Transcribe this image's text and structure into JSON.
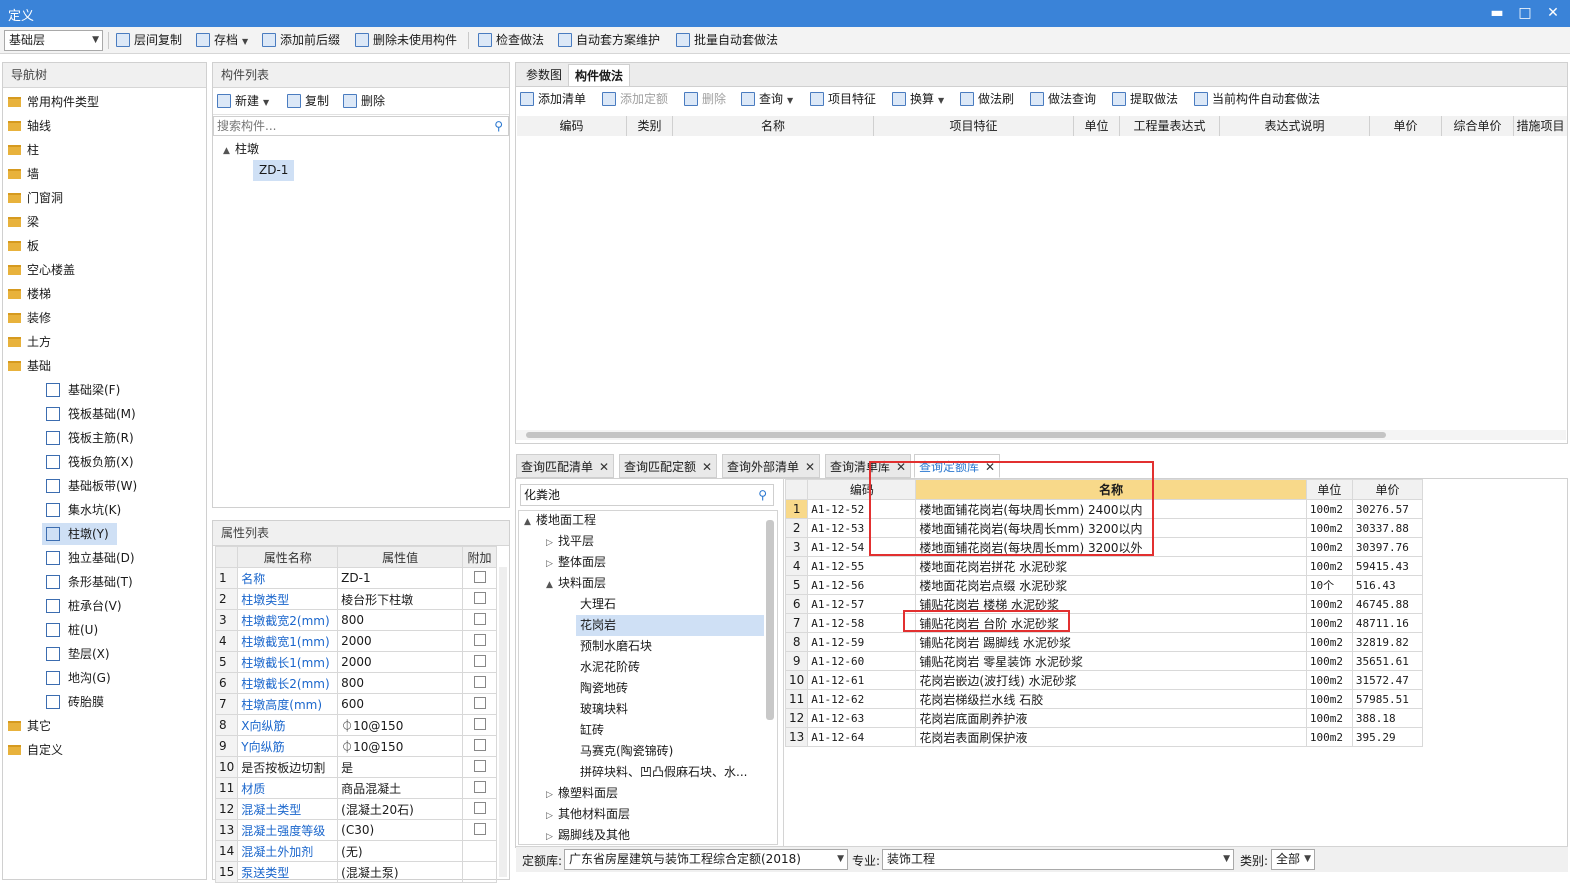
{
  "window": {
    "title": "定义"
  },
  "window_controls": {
    "minimize": "▬",
    "maximize": "□",
    "close": "✕"
  },
  "toolbar": {
    "layer": "基础层",
    "buttons": [
      "层间复制",
      "存档",
      "添加前后缀",
      "删除未使用构件",
      "检查做法",
      "自动套方案维护",
      "批量自动套做法"
    ]
  },
  "nav": {
    "title": "导航树",
    "items": [
      "常用构件类型",
      "轴线",
      "柱",
      "墙",
      "门窗洞",
      "梁",
      "板",
      "空心楼盖",
      "楼梯",
      "装修",
      "土方",
      "基础"
    ],
    "sub_items": [
      "基础梁(F)",
      "筏板基础(M)",
      "筏板主筋(R)",
      "筏板负筋(X)",
      "基础板带(W)",
      "集水坑(K)",
      "柱墩(Y)",
      "独立基础(D)",
      "条形基础(T)",
      "桩承台(V)",
      "桩(U)",
      "垫层(X)",
      "地沟(G)",
      "砖胎膜"
    ],
    "tail_items": [
      "其它",
      "自定义"
    ]
  },
  "component_list": {
    "title": "构件列表",
    "new_label": "新建",
    "copy_label": "复制",
    "delete_label": "删除",
    "search_placeholder": "搜索构件...",
    "root": "柱墩",
    "child": "ZD-1"
  },
  "properties": {
    "title": "属性列表",
    "headers": [
      "属性名称",
      "属性值",
      "附加"
    ],
    "rows": [
      {
        "n": "1",
        "name": "名称",
        "value": "ZD-1"
      },
      {
        "n": "2",
        "name": "柱墩类型",
        "value": "棱台形下柱墩"
      },
      {
        "n": "3",
        "name": "柱墩截宽2(mm)",
        "value": "800"
      },
      {
        "n": "4",
        "name": "柱墩截宽1(mm)",
        "value": "2000"
      },
      {
        "n": "5",
        "name": "柱墩截长1(mm)",
        "value": "2000"
      },
      {
        "n": "6",
        "name": "柱墩截长2(mm)",
        "value": "800"
      },
      {
        "n": "7",
        "name": "柱墩高度(mm)",
        "value": "600"
      },
      {
        "n": "8",
        "name": "X向纵筋",
        "value": "⏀10@150"
      },
      {
        "n": "9",
        "name": "Y向纵筋",
        "value": "⏀10@150"
      },
      {
        "n": "10",
        "name": "是否按板边切割",
        "value": "是"
      },
      {
        "n": "11",
        "name": "材质",
        "value": "商品混凝土"
      },
      {
        "n": "12",
        "name": "混凝土类型",
        "value": "(混凝土20石)"
      },
      {
        "n": "13",
        "name": "混凝土强度等级",
        "value": "(C30)"
      },
      {
        "n": "14",
        "name": "混凝土外加剂",
        "value": "(无)"
      },
      {
        "n": "15",
        "name": "泵送类型",
        "value": "(混凝土泵)"
      }
    ]
  },
  "right": {
    "tabs": [
      "参数图",
      "构件做法"
    ],
    "actions": [
      "添加清单",
      "添加定额",
      "删除",
      "查询",
      "项目特征",
      "换算",
      "做法刷",
      "做法查询",
      "提取做法",
      "当前构件自动套做法"
    ],
    "columns": [
      "编码",
      "类别",
      "名称",
      "项目特征",
      "单位",
      "工程量表达式",
      "表达式说明",
      "单价",
      "综合单价",
      "措施项目"
    ]
  },
  "query": {
    "tabs": [
      "查询匹配清单",
      "查询匹配定额",
      "查询外部清单",
      "查询清单库",
      "查询定额库"
    ],
    "search_value": "化粪池",
    "tree": [
      {
        "label": "楼地面工程",
        "level": 0,
        "arrow": "▲"
      },
      {
        "label": "找平层",
        "level": 1,
        "arrow": "▷"
      },
      {
        "label": "整体面层",
        "level": 1,
        "arrow": "▷"
      },
      {
        "label": "块料面层",
        "level": 1,
        "arrow": "▲"
      },
      {
        "label": "大理石",
        "level": 2,
        "arrow": ""
      },
      {
        "label": "花岗岩",
        "level": 2,
        "arrow": ""
      },
      {
        "label": "预制水磨石块",
        "level": 2,
        "arrow": ""
      },
      {
        "label": "水泥花阶砖",
        "level": 2,
        "arrow": ""
      },
      {
        "label": "陶瓷地砖",
        "level": 2,
        "arrow": ""
      },
      {
        "label": "玻璃块料",
        "level": 2,
        "arrow": ""
      },
      {
        "label": "缸砖",
        "level": 2,
        "arrow": ""
      },
      {
        "label": "马赛克(陶瓷锦砖)",
        "level": 2,
        "arrow": ""
      },
      {
        "label": "拼碎块料、凹凸假麻石块、水...",
        "level": 2,
        "arrow": ""
      },
      {
        "label": "橡塑料面层",
        "level": 1,
        "arrow": "▷"
      },
      {
        "label": "其他材料面层",
        "level": 1,
        "arrow": "▷"
      },
      {
        "label": "踢脚线及其他",
        "level": 1,
        "arrow": "▷"
      }
    ],
    "grid_headers": [
      "编码",
      "名称",
      "单位",
      "单价"
    ],
    "rows": [
      {
        "n": "1",
        "code": "A1-12-52",
        "name": "楼地面铺花岗岩(每块周长mm) 2400以内",
        "unit": "100m2",
        "price": "30276.57"
      },
      {
        "n": "2",
        "code": "A1-12-53",
        "name": "楼地面铺花岗岩(每块周长mm) 3200以内",
        "unit": "100m2",
        "price": "30337.88"
      },
      {
        "n": "3",
        "code": "A1-12-54",
        "name": "楼地面铺花岗岩(每块周长mm) 3200以外",
        "unit": "100m2",
        "price": "30397.76"
      },
      {
        "n": "4",
        "code": "A1-12-55",
        "name": "楼地面花岗岩拼花 水泥砂浆",
        "unit": "100m2",
        "price": "59415.43"
      },
      {
        "n": "5",
        "code": "A1-12-56",
        "name": "楼地面花岗岩点缀 水泥砂浆",
        "unit": "10个",
        "price": "516.43"
      },
      {
        "n": "6",
        "code": "A1-12-57",
        "name": "铺贴花岗岩 楼梯 水泥砂浆",
        "unit": "100m2",
        "price": "46745.88"
      },
      {
        "n": "7",
        "code": "A1-12-58",
        "name": "铺贴花岗岩 台阶 水泥砂浆",
        "unit": "100m2",
        "price": "48711.16"
      },
      {
        "n": "8",
        "code": "A1-12-59",
        "name": "铺贴花岗岩 踢脚线 水泥砂浆",
        "unit": "100m2",
        "price": "32819.82"
      },
      {
        "n": "9",
        "code": "A1-12-60",
        "name": "铺贴花岗岩 零星装饰 水泥砂浆",
        "unit": "100m2",
        "price": "35651.61"
      },
      {
        "n": "10",
        "code": "A1-12-61",
        "name": "花岗岩嵌边(波打线) 水泥砂浆",
        "unit": "100m2",
        "price": "31572.47"
      },
      {
        "n": "11",
        "code": "A1-12-62",
        "name": "花岗岩梯级拦水线 石胶",
        "unit": "100m2",
        "price": "57985.51"
      },
      {
        "n": "12",
        "code": "A1-12-63",
        "name": "花岗岩底面刷养护液",
        "unit": "100m2",
        "price": "388.18"
      },
      {
        "n": "13",
        "code": "A1-12-64",
        "name": "花岗岩表面刷保护液",
        "unit": "100m2",
        "price": "395.29"
      }
    ],
    "footer": {
      "lib_label": "定额库:",
      "lib_value": "广东省房屋建筑与装饰工程综合定额(2018)",
      "spec_label": "专业:",
      "spec_value": "装饰工程",
      "cat_label": "类别:",
      "cat_value": "全部"
    }
  },
  "colors": {
    "titlebar": "#3a83d8",
    "highlight": "#e23030",
    "link": "#1a66cc",
    "selected": "#cfe0f5"
  }
}
